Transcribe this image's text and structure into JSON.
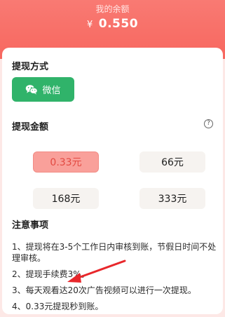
{
  "header": {
    "label": "我的余额",
    "currency": "¥",
    "balance": "0.550"
  },
  "withdraw_method": {
    "title": "提现方式",
    "button_label": "微信",
    "button_color": "#30b36a"
  },
  "withdraw_amount": {
    "title": "提现金额",
    "help_icon": "?",
    "options": [
      {
        "label": "0.33元",
        "selected": true
      },
      {
        "label": "66元",
        "selected": false
      },
      {
        "label": "168元",
        "selected": false
      },
      {
        "label": "333元",
        "selected": false
      }
    ]
  },
  "notes": {
    "title": "注意事项",
    "items": [
      "1、提现将在3-5个工作日内审核到账，节假日时间不处理审核。",
      "2、提现手续费3%。",
      "3、每天观看达20次广告视频可以进行一次提现。",
      "4、0.33元提现秒到账。"
    ]
  },
  "colors": {
    "accent": "#f7675f",
    "selected_text": "#e34941",
    "annotation_arrow": "#e8272b"
  }
}
